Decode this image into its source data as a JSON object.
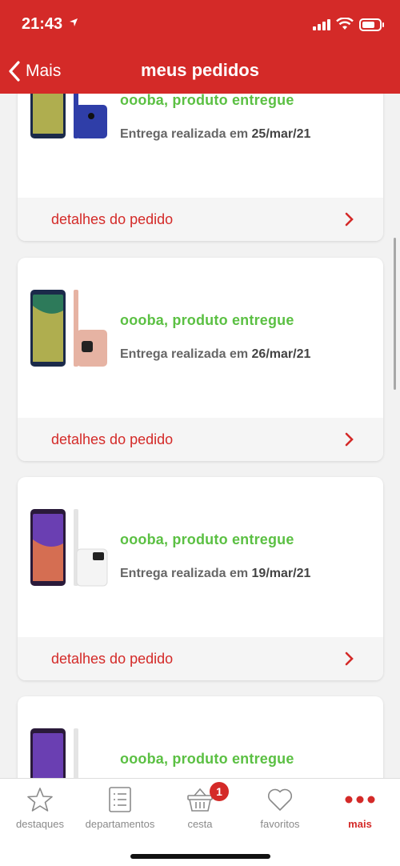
{
  "status_bar": {
    "time": "21:43"
  },
  "nav": {
    "back_label": "Mais",
    "title": "meus pedidos"
  },
  "orders": [
    {
      "status": "oooba, produto entregue",
      "delivery_prefix": "Entrega realizada em",
      "delivery_date": "25/mar/21",
      "details_label": "detalhes do pedido",
      "phone_colors": {
        "front": "#1b2a4a",
        "back": "#2f3ea8"
      }
    },
    {
      "status": "oooba, produto entregue",
      "delivery_prefix": "Entrega realizada em",
      "delivery_date": "26/mar/21",
      "details_label": "detalhes do pedido",
      "phone_colors": {
        "front": "#1b2a4a",
        "back": "#e6b3a3"
      }
    },
    {
      "status": "oooba, produto entregue",
      "delivery_prefix": "Entrega realizada em",
      "delivery_date": "19/mar/21",
      "details_label": "detalhes do pedido",
      "phone_colors": {
        "front": "#2a1a3a",
        "back": "#f4f4f4"
      }
    },
    {
      "status": "oooba, produto entregue",
      "delivery_prefix": "",
      "delivery_date": "",
      "details_label": "",
      "phone_colors": {
        "front": "#2a1a3a",
        "back": "#f4f4f4"
      }
    }
  ],
  "tabbar": {
    "tabs": [
      {
        "label": "destaques",
        "icon": "star-icon"
      },
      {
        "label": "departamentos",
        "icon": "list-icon"
      },
      {
        "label": "cesta",
        "icon": "basket-icon",
        "badge": "1"
      },
      {
        "label": "favoritos",
        "icon": "heart-icon"
      },
      {
        "label": "mais",
        "icon": "more-icon",
        "active": true
      }
    ]
  },
  "colors": {
    "brand": "#d42a28",
    "success": "#5bc043"
  }
}
